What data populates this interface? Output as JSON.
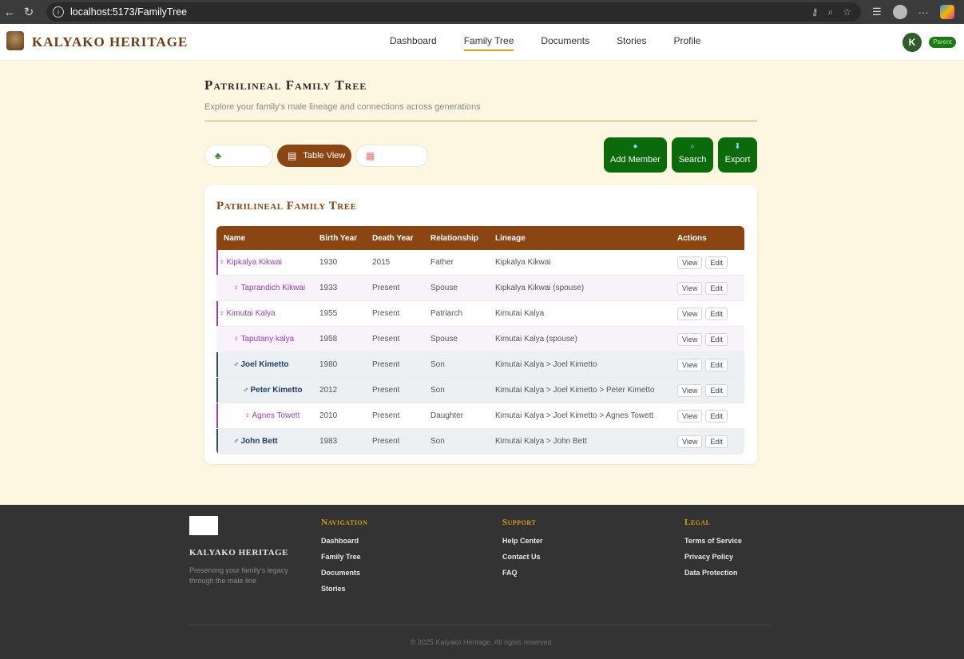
{
  "browser": {
    "url": "localhost:5173/FamilyTree",
    "back": "←",
    "reload": "↻",
    "info": "i",
    "more": "···"
  },
  "header": {
    "brand": "KALYAKO HERITAGE",
    "nav": [
      "Dashboard",
      "Family Tree",
      "Documents",
      "Stories",
      "Profile"
    ],
    "active_nav": "Family Tree",
    "avatar_initial": "K",
    "role_badge": "Parent"
  },
  "page": {
    "title": "Patrilineal Family Tree",
    "subtitle": "Explore your family's male lineage and connections across generations"
  },
  "view_toggle": {
    "tree_label": "",
    "table_label": "Table View",
    "doc_label": ""
  },
  "actions": {
    "add_member": "Add Member",
    "search": "Search",
    "export": "Export"
  },
  "table": {
    "title": "Patrilineal Family Tree",
    "columns": [
      "Name",
      "Birth Year",
      "Death Year",
      "Relationship",
      "Lineage",
      "Actions"
    ],
    "view_label": "View",
    "edit_label": "Edit",
    "rows": [
      {
        "name": "Kipkalya Kikwai",
        "birth": "1930",
        "death": "2015",
        "relationship": "Father",
        "lineage": "Kipkalya Kikwai",
        "gender": "female-marker",
        "symbol": "♀"
      },
      {
        "name": "Taprandich Kikwai",
        "birth": "1933",
        "death": "Present",
        "relationship": "Spouse",
        "lineage": "Kipkalya Kikwai (spouse)",
        "gender": "female",
        "symbol": "♀"
      },
      {
        "name": "Kimutai Kalya",
        "birth": "1955",
        "death": "Present",
        "relationship": "Patriarch",
        "lineage": "Kimutai Kalya",
        "gender": "female-marker",
        "symbol": "♀"
      },
      {
        "name": "Taputany kalya",
        "birth": "1958",
        "death": "Present",
        "relationship": "Spouse",
        "lineage": "Kimutai Kalya (spouse)",
        "gender": "female",
        "symbol": "♀"
      },
      {
        "name": "Joel Kimetto",
        "birth": "1980",
        "death": "Present",
        "relationship": "Son",
        "lineage": "Kimutai Kalya > Joel Kimetto",
        "gender": "male",
        "symbol": "♂"
      },
      {
        "name": "Peter Kimetto",
        "birth": "2012",
        "death": "Present",
        "relationship": "Son",
        "lineage": "Kimutai Kalya > Joel Kimetto > Peter Kimetto",
        "gender": "male",
        "symbol": "♂"
      },
      {
        "name": "Agnes Towett",
        "birth": "2010",
        "death": "Present",
        "relationship": "Daughter",
        "lineage": "Kimutai Kalya > Joel Kimetto > Agnes Towett",
        "gender": "female-child",
        "symbol": "♀"
      },
      {
        "name": "John Bett",
        "birth": "1983",
        "death": "Present",
        "relationship": "Son",
        "lineage": "Kimutai Kalya > John Bett",
        "gender": "male",
        "symbol": "♂"
      }
    ]
  },
  "footer": {
    "brand": "KALYAKO HERITAGE",
    "tagline": "Preserving your family's legacy through the male line",
    "navigation": {
      "title": "Navigation",
      "links": [
        "Dashboard",
        "Family Tree",
        "Documents",
        "Stories"
      ]
    },
    "support": {
      "title": "Support",
      "links": [
        "Help Center",
        "Contact Us",
        "FAQ"
      ]
    },
    "legal": {
      "title": "Legal",
      "links": [
        "Terms of Service",
        "Privacy Policy",
        "Data Protection"
      ]
    },
    "copyright": "© 2025 Kalyako Heritage. All rights reserved."
  },
  "colors": {
    "brand_brown": "#8b4513",
    "action_green": "#0b6b0b",
    "female_accent": "#9b3fb5",
    "male_accent": "#2c4d75",
    "page_bg": "#fdf6e0"
  }
}
